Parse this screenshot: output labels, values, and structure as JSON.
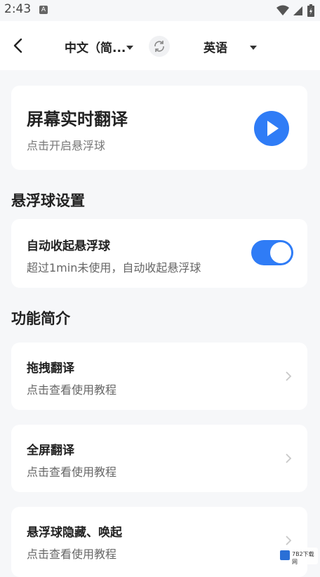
{
  "status": {
    "time": "2:43",
    "notif": "A"
  },
  "header": {
    "source_lang": "中文（简...",
    "target_lang": "英语"
  },
  "realtime": {
    "title": "屏幕实时翻译",
    "subtitle": "点击开启悬浮球"
  },
  "floating_ball_settings": {
    "heading": "悬浮球设置",
    "auto_collapse": {
      "title": "自动收起悬浮球",
      "subtitle": "超过1min未使用，自动收起悬浮球",
      "enabled": true
    }
  },
  "features": {
    "heading": "功能简介",
    "items": [
      {
        "title": "拖拽翻译",
        "subtitle": "点击查看使用教程"
      },
      {
        "title": "全屏翻译",
        "subtitle": "点击查看使用教程"
      },
      {
        "title": "悬浮球隐藏、唤起",
        "subtitle": "点击查看使用教程"
      }
    ]
  },
  "watermark": {
    "text": "7B2下载网"
  },
  "colors": {
    "accent": "#2f7cf6",
    "background": "#f6f7f9"
  }
}
